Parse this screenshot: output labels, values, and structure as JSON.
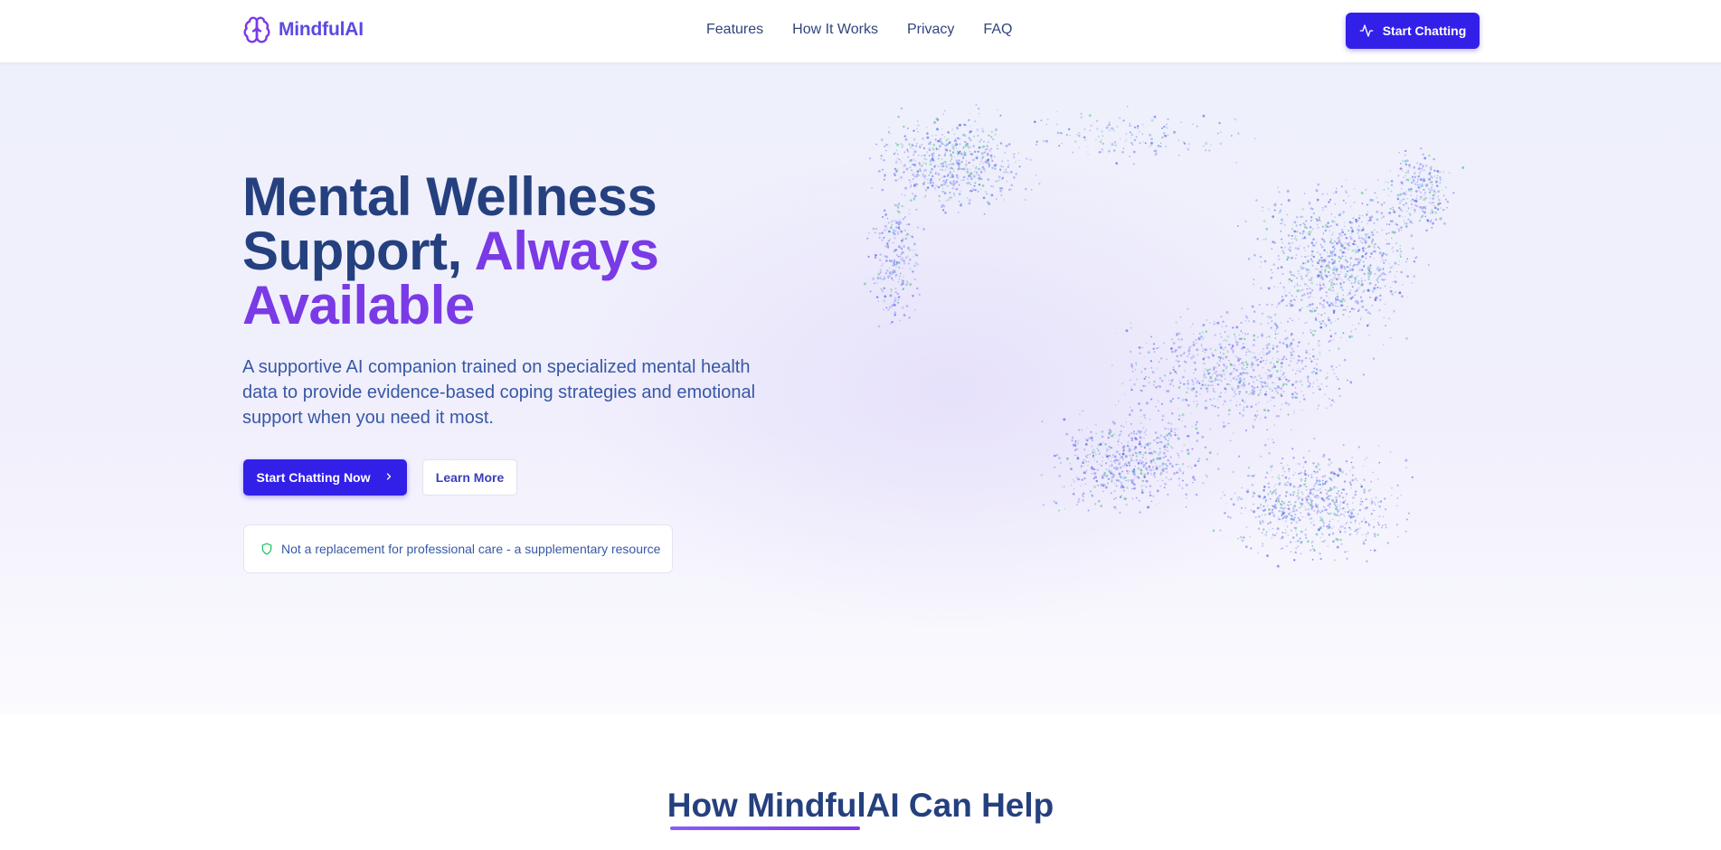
{
  "brand": {
    "name": "MindfulAI",
    "logo_icon": "brain-icon"
  },
  "nav": {
    "links": [
      "Features",
      "How It Works",
      "Privacy",
      "FAQ"
    ],
    "cta_label": "Start Chatting",
    "cta_icon": "activity-icon"
  },
  "hero": {
    "title_line1": "Mental Wellness",
    "title_line2_prefix": "Support, ",
    "title_line2_accent": "Always",
    "title_line3_accent": "Available",
    "description": "A supportive AI companion trained on specialized mental health data to provide evidence-based coping strategies and emotional support when you need it most.",
    "primary_button": "Start Chatting Now",
    "primary_button_icon": "chevron-right-icon",
    "secondary_button": "Learn More",
    "disclaimer": "Not a replacement for professional care - a supplementary resource",
    "disclaimer_icon": "shield-icon"
  },
  "section": {
    "title": "How MindfulAI Can Help"
  },
  "colors": {
    "primary": "#3320e8",
    "brand": "#5b4ae0",
    "heading": "#25407e",
    "accent": "#7a3ae6",
    "body_text": "#3658a6",
    "shield": "#22c55e"
  }
}
